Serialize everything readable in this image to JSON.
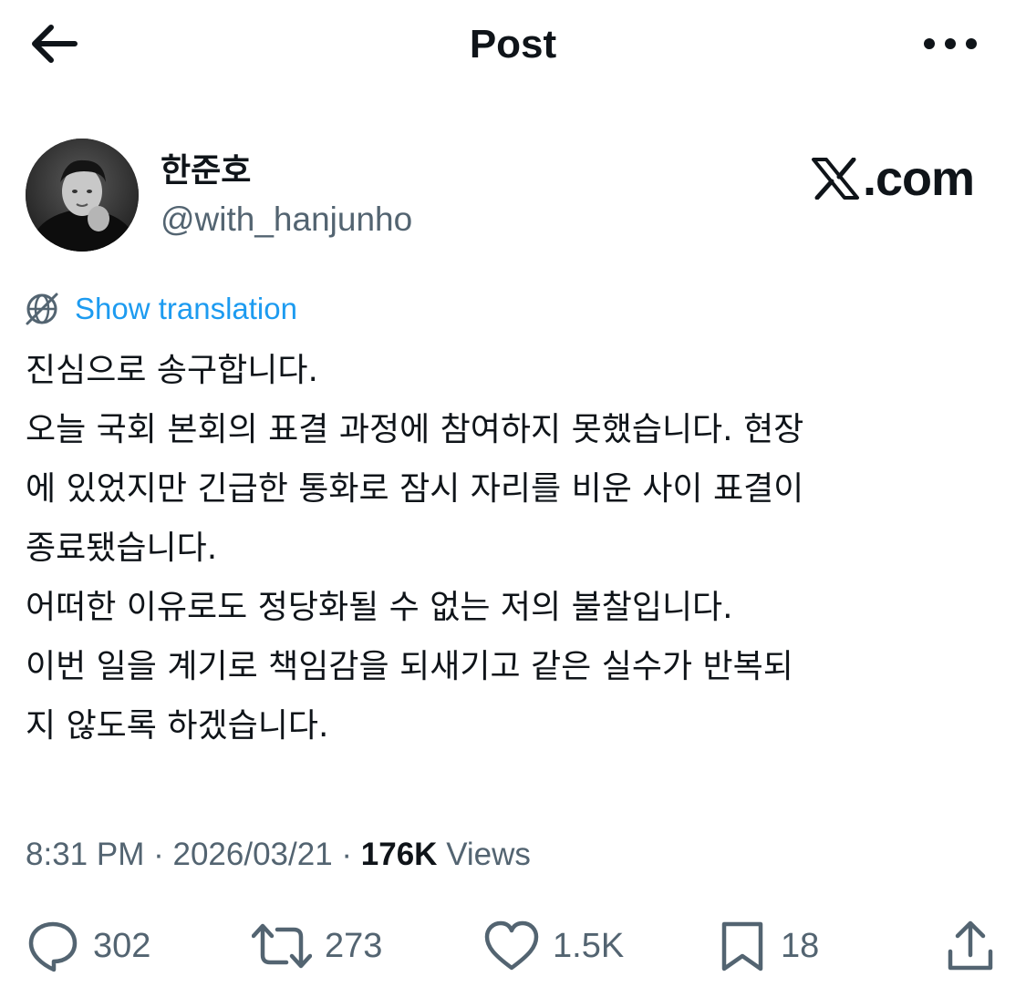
{
  "header": {
    "title": "Post"
  },
  "author": {
    "display_name": "한준호",
    "handle": "@with_hanjunho",
    "watermark": "X.com",
    "watermark_suffix": ".com"
  },
  "translate": {
    "label": "Show translation"
  },
  "post": {
    "lines": [
      "진심으로 송구합니다.",
      "오늘 국회 본회의 표결 과정에 참여하지 못했습니다. 현장",
      "에 있었지만 긴급한 통화로 잠시 자리를 비운 사이 표결이",
      "종료됐습니다.",
      "어떠한 이유로도 정당화될 수 없는 저의 불찰입니다.",
      "이번 일을 계기로 책임감을 되새기고 같은 실수가 반복되",
      "지 않도록 하겠습니다."
    ]
  },
  "meta": {
    "time": "8:31 PM",
    "date": "2026/03/21",
    "separator": "·",
    "views_count": "176K",
    "views_label": "Views"
  },
  "actions": {
    "replies": "302",
    "reposts": "273",
    "likes": "1.5K",
    "bookmarks": "18"
  },
  "icons": {
    "back": "arrow-left-icon",
    "more": "more-dots-icon",
    "translate": "globe-icon",
    "reply": "comment-icon",
    "repost": "repost-icon",
    "like": "heart-icon",
    "bookmark": "bookmark-icon",
    "share": "share-icon"
  },
  "colors": {
    "text": "#0f1419",
    "secondary": "#536471",
    "link": "#1d9bf0",
    "background": "#ffffff"
  }
}
